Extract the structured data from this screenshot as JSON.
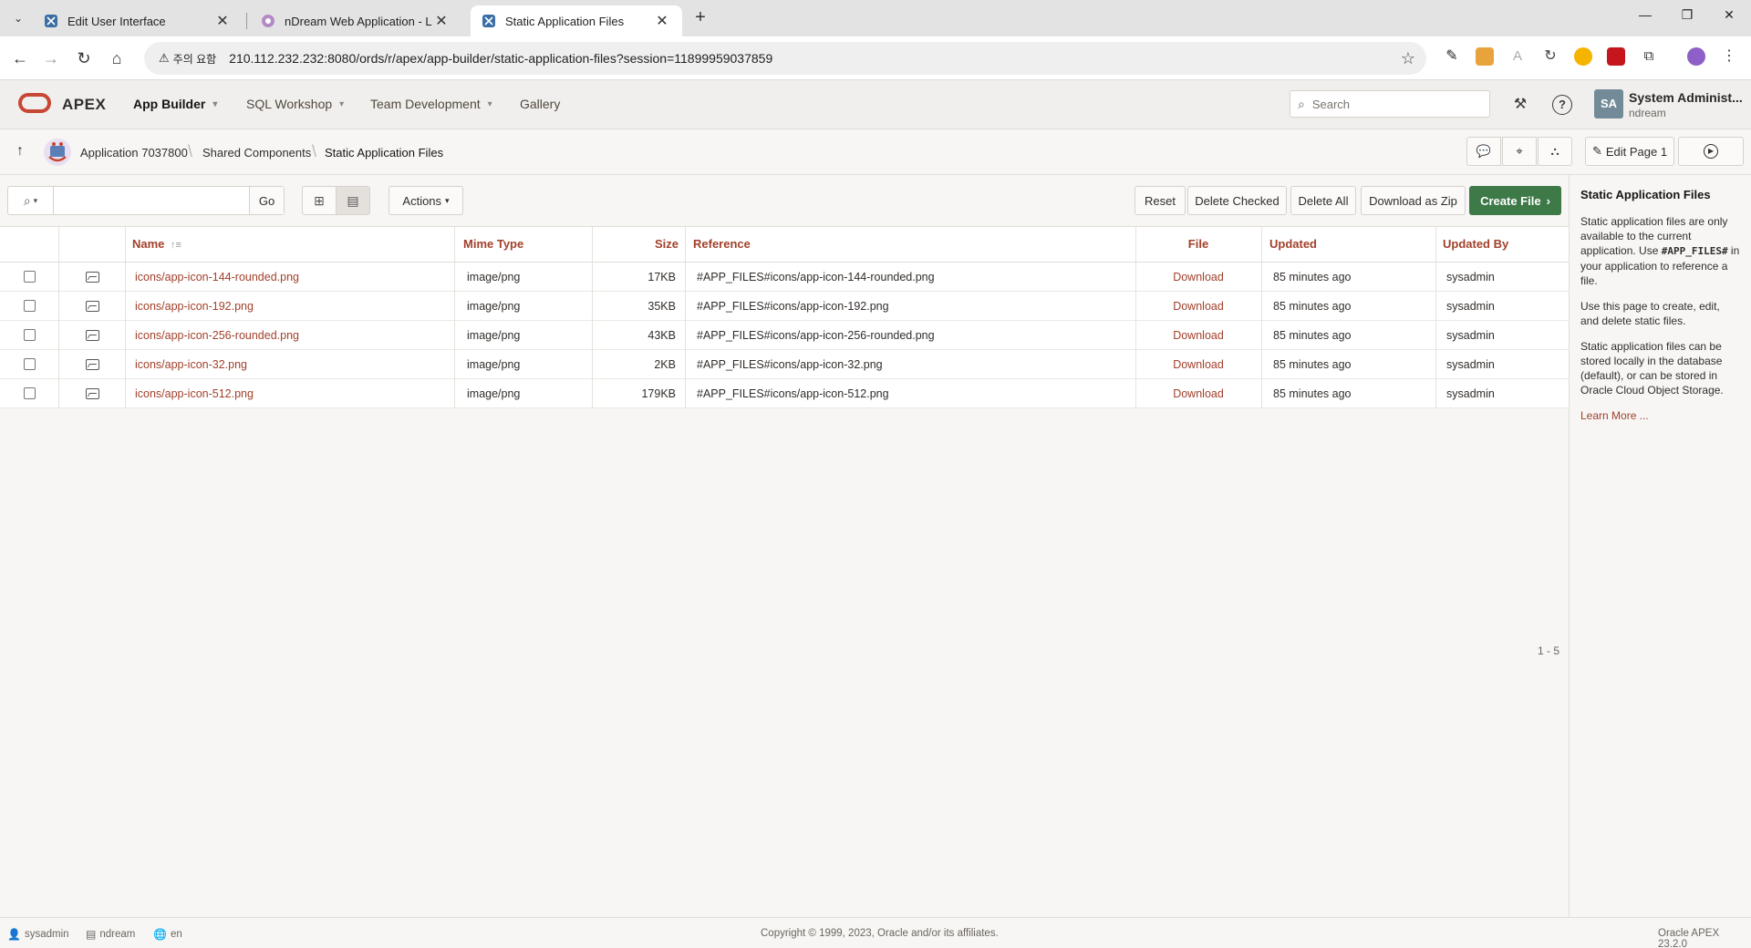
{
  "browser": {
    "tabs": [
      {
        "title": "Edit User Interface"
      },
      {
        "title": "nDream Web Application - Lo"
      },
      {
        "title": "Static Application Files"
      }
    ],
    "security_chip": "주의 요함",
    "url": "210.112.232.232:8080/ords/r/apex/app-builder/static-application-files?session=11899959037859"
  },
  "header": {
    "product": "APEX",
    "nav": [
      {
        "label": "App Builder"
      },
      {
        "label": "SQL Workshop"
      },
      {
        "label": "Team Development"
      },
      {
        "label": "Gallery"
      }
    ],
    "search_placeholder": "Search",
    "user": {
      "initials": "SA",
      "name": "System Administ...",
      "workspace": "ndream"
    }
  },
  "breadcrumb": {
    "items": [
      "Application 7037800",
      "Shared Components",
      "Static Application Files"
    ],
    "edit_page_label": "Edit Page 1"
  },
  "toolbar": {
    "go_label": "Go",
    "actions_label": "Actions",
    "reset_label": "Reset",
    "delete_checked_label": "Delete Checked",
    "delete_all_label": "Delete All",
    "download_zip_label": "Download as Zip",
    "create_file_label": "Create File"
  },
  "table": {
    "columns": [
      "Name",
      "Mime Type",
      "Size",
      "Reference",
      "File",
      "Updated",
      "Updated By"
    ],
    "rows": [
      {
        "name": "icons/app-icon-144-rounded.png",
        "mime": "image/png",
        "size": "17KB",
        "reference": "#APP_FILES#icons/app-icon-144-rounded.png",
        "file": "Download",
        "updated": "85 minutes ago",
        "updated_by": "sysadmin"
      },
      {
        "name": "icons/app-icon-192.png",
        "mime": "image/png",
        "size": "35KB",
        "reference": "#APP_FILES#icons/app-icon-192.png",
        "file": "Download",
        "updated": "85 minutes ago",
        "updated_by": "sysadmin"
      },
      {
        "name": "icons/app-icon-256-rounded.png",
        "mime": "image/png",
        "size": "43KB",
        "reference": "#APP_FILES#icons/app-icon-256-rounded.png",
        "file": "Download",
        "updated": "85 minutes ago",
        "updated_by": "sysadmin"
      },
      {
        "name": "icons/app-icon-32.png",
        "mime": "image/png",
        "size": "2KB",
        "reference": "#APP_FILES#icons/app-icon-32.png",
        "file": "Download",
        "updated": "85 minutes ago",
        "updated_by": "sysadmin"
      },
      {
        "name": "icons/app-icon-512.png",
        "mime": "image/png",
        "size": "179KB",
        "reference": "#APP_FILES#icons/app-icon-512.png",
        "file": "Download",
        "updated": "85 minutes ago",
        "updated_by": "sysadmin"
      }
    ],
    "pagination": "1 - 5"
  },
  "help": {
    "title": "Static Application Files",
    "p1_before": "Static application files are only available to the current application. Use ",
    "p1_code": "#APP_FILES#",
    "p1_after": " in your application to reference a file.",
    "p2": "Use this page to create, edit, and delete static files.",
    "p3": "Static application files can be stored locally in the database (default), or can be stored in Oracle Cloud Object Storage.",
    "learn_more": "Learn More ..."
  },
  "footer": {
    "user": "sysadmin",
    "workspace": "ndream",
    "language": "en",
    "copyright": "Copyright © 1999, 2023, Oracle and/or its affiliates.",
    "version": "Oracle APEX 23.2.0"
  },
  "colors": {
    "accent": "#a1402b",
    "create_button": "#3e7a48",
    "oracle_red": "#c74634"
  }
}
